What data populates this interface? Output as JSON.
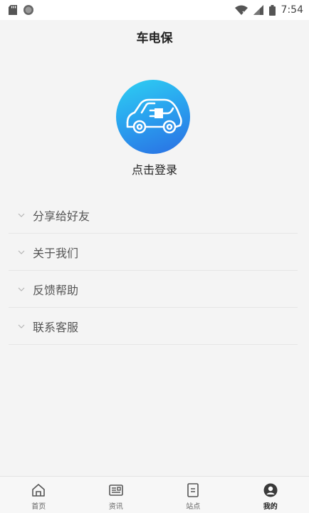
{
  "status_bar": {
    "time": "7:54"
  },
  "header": {
    "title": "车电保"
  },
  "profile": {
    "login_label": "点击登录"
  },
  "menu": {
    "items": [
      {
        "label": "分享给好友"
      },
      {
        "label": "关于我们"
      },
      {
        "label": "反馈帮助"
      },
      {
        "label": "联系客服"
      }
    ]
  },
  "bottom_nav": {
    "items": [
      {
        "label": "首页",
        "icon": "home-icon",
        "active": false
      },
      {
        "label": "资讯",
        "icon": "news-icon",
        "active": false
      },
      {
        "label": "站点",
        "icon": "station-icon",
        "active": false
      },
      {
        "label": "我的",
        "icon": "profile-icon",
        "active": true
      }
    ]
  },
  "colors": {
    "accent_blue": "#2a8ff0",
    "background": "#f4f4f4",
    "text_primary": "#222222",
    "text_secondary": "#555555"
  }
}
